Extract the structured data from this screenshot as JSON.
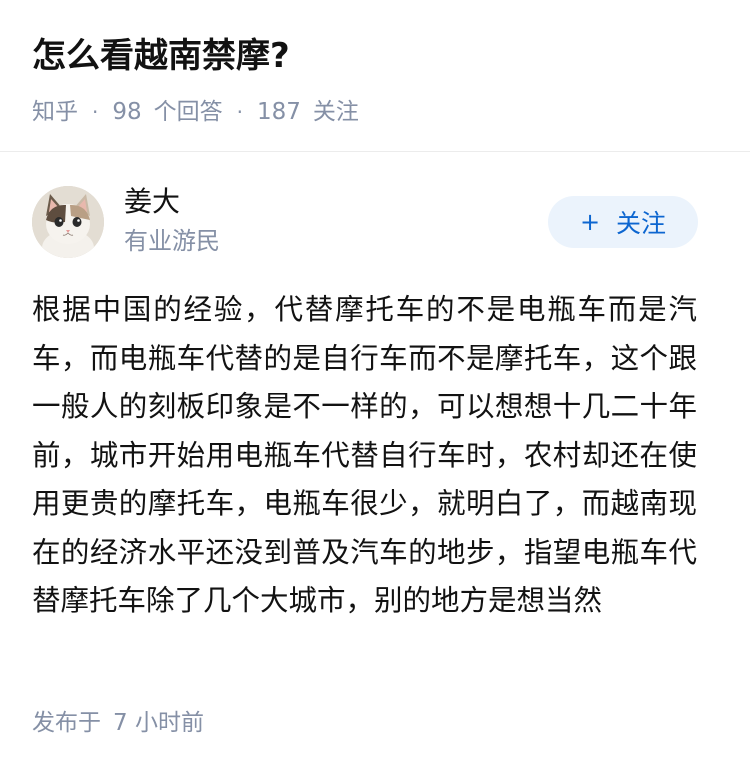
{
  "question": {
    "title": "怎么看越南禁摩?",
    "source": "知乎",
    "separator": "·",
    "answer_count": "98",
    "answer_label": "个回答",
    "follower_count": "187",
    "follower_label": "关注"
  },
  "author": {
    "name": "姜大",
    "headline": "有业游民",
    "avatar_icon": "cat-avatar",
    "follow_label": "关注",
    "follow_icon": "plus-icon",
    "follow_glyph": "+"
  },
  "answer": {
    "content": "根据中国的经验，代替摩托车的不是电瓶车而是汽车，而电瓶车代替的是自行车而不是摩托车，这个跟一般人的刻板印象是不一样的，可以想想十几二十年前，城市开始用电瓶车代替自行车时，农村却还在使用更贵的摩托车，电瓶车很少，就明白了，而越南现在的经济水平还没到普及汽车的地步，指望电瓶车代替摩托车除了几个大城市，别的地方是想当然",
    "published_label": "发布于",
    "published_time": "7 小时前"
  },
  "colors": {
    "meta_gray": "#8590a6",
    "follow_bg": "#ebf3fc",
    "follow_text": "#0d66d0",
    "text": "#121212"
  }
}
